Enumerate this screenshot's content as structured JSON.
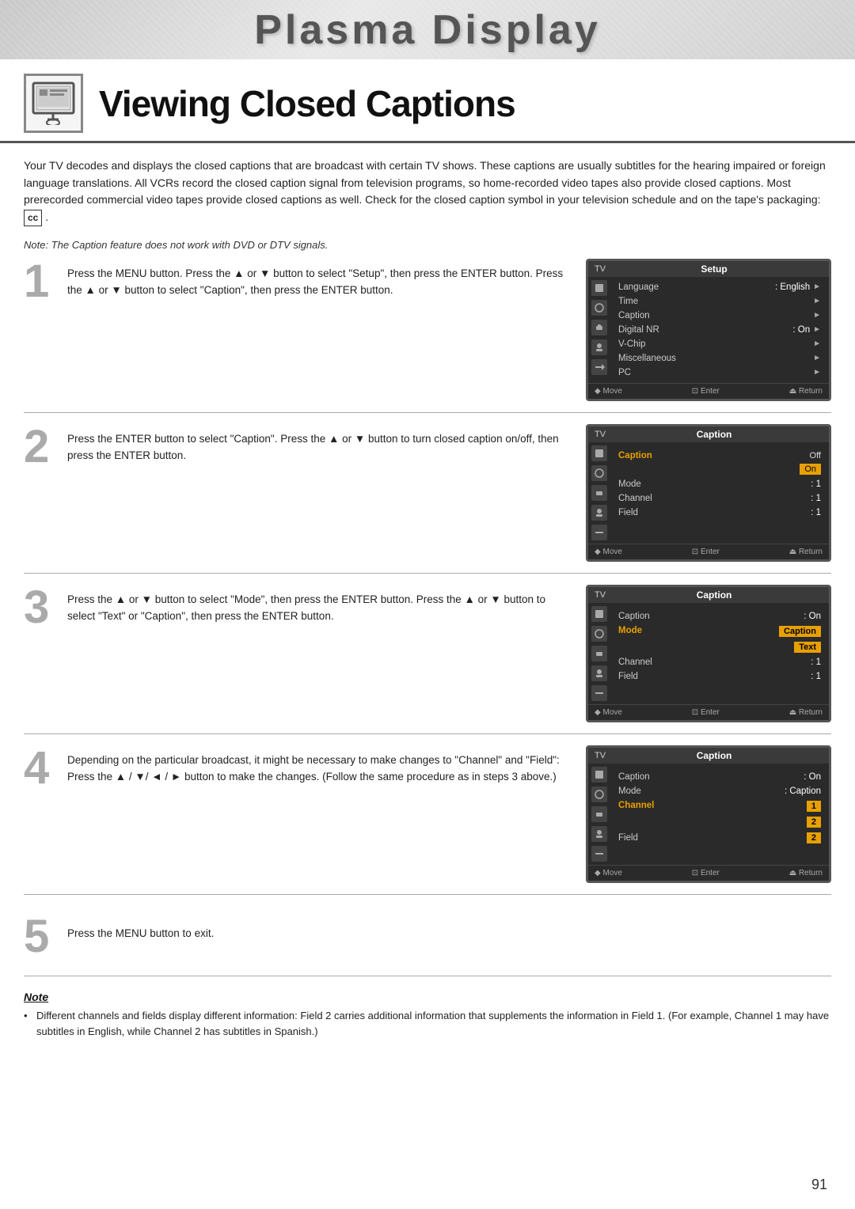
{
  "header": {
    "title": "Plasma Display"
  },
  "page": {
    "title": "Viewing Closed Captions",
    "icon_alt": "TV with hand icon",
    "description": "Your TV decodes and displays the closed captions that are broadcast with certain TV shows. These captions are usually subtitles for the hearing impaired or foreign language translations. All VCRs record the closed caption signal from television programs, so home-recorded video tapes also provide closed captions. Most prerecorded commercial video tapes provide closed captions as well. Check for the closed caption symbol in your television schedule and on the tape's packaging:",
    "cc_symbol": "cc",
    "note_line": "Note: The Caption feature does not work with DVD or DTV signals.",
    "page_number": "91"
  },
  "steps": [
    {
      "number": "1",
      "text": "Press the MENU button. Press the ▲ or ▼  button to select \"Setup\", then press the ENTER button. Press the ▲ or ▼ button to select \"Caption\", then press the ENTER button."
    },
    {
      "number": "2",
      "text": "Press the ENTER button to select \"Caption\". Press the ▲ or ▼ button to turn closed caption on/off, then press the ENTER button."
    },
    {
      "number": "3",
      "text": "Press the ▲ or ▼ button to select \"Mode\", then press the ENTER button. Press the ▲ or ▼ button to select \"Text\" or \"Caption\", then press the ENTER button."
    },
    {
      "number": "4",
      "text": "Depending on the particular broadcast, it might be necessary to make changes to \"Channel\" and \"Field\": Press the ▲ / ▼/ ◄ / ► button to make the changes. (Follow the same procedure as in steps 3 above.)"
    },
    {
      "number": "5",
      "text": "Press the MENU button to exit."
    }
  ],
  "screens": [
    {
      "id": "screen1",
      "tv_label": "TV",
      "menu_label": "Setup",
      "rows": [
        {
          "label": "Language",
          "value": ": English",
          "arrow": "►",
          "highlighted": false
        },
        {
          "label": "Time",
          "value": "",
          "arrow": "►",
          "highlighted": false
        },
        {
          "label": "Caption",
          "value": "",
          "arrow": "►",
          "highlighted": false
        },
        {
          "label": "Digital NR",
          "value": ": On",
          "arrow": "►",
          "highlighted": false
        },
        {
          "label": "V-Chip",
          "value": "",
          "arrow": "►",
          "highlighted": false
        },
        {
          "label": "Miscellaneous",
          "value": "",
          "arrow": "►",
          "highlighted": false
        },
        {
          "label": "PC",
          "value": "",
          "arrow": "►",
          "highlighted": false
        }
      ],
      "bottom": {
        "move": "◆ Move",
        "enter": "🔲 Enter",
        "return": "⏏ Return"
      }
    },
    {
      "id": "screen2",
      "tv_label": "TV",
      "menu_label": "Caption",
      "rows": [
        {
          "label": "Caption",
          "value": "Off",
          "value2": "On",
          "highlighted": true
        },
        {
          "label": "Mode",
          "value": ": 1",
          "arrow": "",
          "highlighted": false
        },
        {
          "label": "Channel",
          "value": ": 1",
          "arrow": "",
          "highlighted": false
        },
        {
          "label": "Field",
          "value": ": 1",
          "arrow": "",
          "highlighted": false
        }
      ],
      "bottom": {
        "move": "◆ Move",
        "enter": "🔲 Enter",
        "return": "⏏ Return"
      }
    },
    {
      "id": "screen3",
      "tv_label": "TV",
      "menu_label": "Caption",
      "rows": [
        {
          "label": "Caption",
          "value": ": On",
          "arrow": "",
          "highlighted": false
        },
        {
          "label": "Mode",
          "value": "Caption",
          "value2": "Text",
          "highlighted": true
        },
        {
          "label": "Channel",
          "value": ": 1",
          "arrow": "",
          "highlighted": false
        },
        {
          "label": "Field",
          "value": ": 1",
          "arrow": "",
          "highlighted": false
        }
      ],
      "bottom": {
        "move": "◆ Move",
        "enter": "🔲 Enter",
        "return": "⏏ Return"
      }
    },
    {
      "id": "screen4",
      "tv_label": "TV",
      "menu_label": "Caption",
      "rows": [
        {
          "label": "Caption",
          "value": ": On",
          "arrow": "",
          "highlighted": false
        },
        {
          "label": "Mode",
          "value": ": Caption",
          "arrow": "",
          "highlighted": false
        },
        {
          "label": "Channel",
          "value": "1",
          "value2": "2",
          "highlighted": true
        },
        {
          "label": "Field",
          "value": "2",
          "arrow": "",
          "highlighted": false
        }
      ],
      "bottom": {
        "move": "◆ Move",
        "enter": "🔲 Enter",
        "return": "⏏ Return"
      }
    }
  ],
  "note": {
    "title": "Note",
    "bullets": [
      "Different channels and fields display different information: Field 2 carries additional information that supplements the information in Field 1. (For example, Channel 1 may have subtitles in English, while Channel 2 has subtitles in Spanish.)"
    ]
  }
}
